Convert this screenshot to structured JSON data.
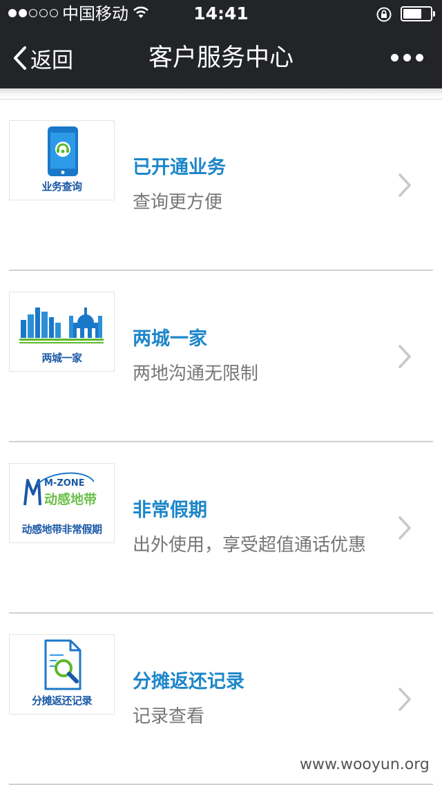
{
  "status_bar": {
    "carrier": "中国移动",
    "time": "14:41",
    "signal_strength": 2,
    "signal_max": 5,
    "battery_level": 0.6
  },
  "nav": {
    "back_label": "返回",
    "title": "客户服务中心",
    "more_icon": "more-dots-icon"
  },
  "services": [
    {
      "name": "已开通业务",
      "description": "查询更方便",
      "thumb_caption": "业务查询",
      "icon": "phone-headset-icon"
    },
    {
      "name": "两城一家",
      "description": "两地沟通无限制",
      "thumb_caption": "两城一家",
      "icon": "city-skyline-icon"
    },
    {
      "name": "非常假期",
      "description": "出外使用，享受超值通话优惠",
      "thumb_caption": "动感地带非常假期",
      "icon": "mzone-logo-icon",
      "logo_text": "M-ZONE",
      "logo_subtext": "动感地带"
    },
    {
      "name": "分摊返还记录",
      "description": "记录查看",
      "thumb_caption": "分摊返还记录",
      "icon": "document-search-icon"
    }
  ],
  "watermark": "www.wooyun.org",
  "colors": {
    "bar_bg": "#222428",
    "title_blue": "#1d86c9",
    "desc_gray": "#767676",
    "thumb_caption_blue": "#1a58a6"
  }
}
